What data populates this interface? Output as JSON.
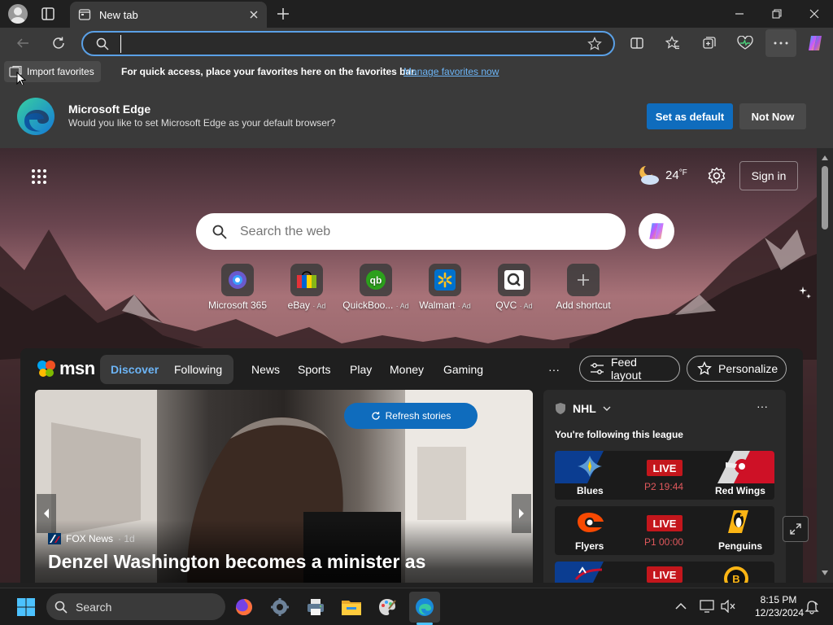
{
  "browser": {
    "tab": {
      "title": "New tab"
    },
    "address": {
      "value": "",
      "placeholder": ""
    },
    "favorites_bar": {
      "import_label": "Import favorites",
      "message": "For quick access, place your favorites here on the favorites bar.",
      "manage_link": "Manage favorites now"
    },
    "default_banner": {
      "title": "Microsoft Edge",
      "message": "Would you like to set Microsoft Edge as your default browser?",
      "set_default_label": "Set as default",
      "not_now_label": "Not Now"
    }
  },
  "newtab": {
    "weather": {
      "temp": "24",
      "unit": "°F",
      "icon": "partly-cloudy-night-icon"
    },
    "signin_label": "Sign in",
    "search_placeholder": "Search the web",
    "quick_links": [
      {
        "label": "Microsoft 365",
        "ad": "",
        "icon": "m365-icon"
      },
      {
        "label": "eBay",
        "ad": "· Ad",
        "icon": "ebay-icon"
      },
      {
        "label": "QuickBoo...",
        "ad": "· Ad",
        "icon": "quickbooks-icon"
      },
      {
        "label": "Walmart",
        "ad": "· Ad",
        "icon": "walmart-icon"
      },
      {
        "label": "QVC",
        "ad": "· Ad",
        "icon": "qvc-icon"
      },
      {
        "label": "Add shortcut",
        "ad": "",
        "icon": "plus-icon"
      }
    ]
  },
  "msn": {
    "brand": "msn",
    "tabs": {
      "discover": "Discover",
      "following": "Following"
    },
    "nav": [
      "News",
      "Sports",
      "Play",
      "Money",
      "Gaming"
    ],
    "more": "···",
    "feed_layout_label": "Feed layout",
    "personalize_label": "Personalize",
    "hero": {
      "refresh_label": "Refresh stories",
      "source": "FOX News",
      "age": "· 1d",
      "headline": "Denzel Washington becomes a minister as"
    },
    "nhl": {
      "title": "NHL",
      "subtitle": "You're following this league",
      "games": [
        {
          "home": "Blues",
          "away": "Red Wings",
          "status": "LIVE",
          "time": "P2 19:44",
          "home_color": "#0b3d91",
          "away_color": "#ce1126"
        },
        {
          "home": "Flyers",
          "away": "Penguins",
          "status": "LIVE",
          "time": "P1 00:00",
          "home_color": "#1b1b1b",
          "away_color": "#1b1b1b"
        },
        {
          "home": "",
          "away": "",
          "status": "LIVE",
          "time": "",
          "home_color": "#0b3d91",
          "away_color": "#1b1b1b"
        }
      ]
    }
  },
  "taskbar": {
    "search_label": "Search",
    "clock": {
      "time": "8:15 PM",
      "date": "12/23/2024"
    }
  },
  "colors": {
    "accent": "#0f6cbd",
    "focus_ring": "#5aa0e6",
    "live_red": "#c4161c",
    "link": "#6cb4f5"
  }
}
